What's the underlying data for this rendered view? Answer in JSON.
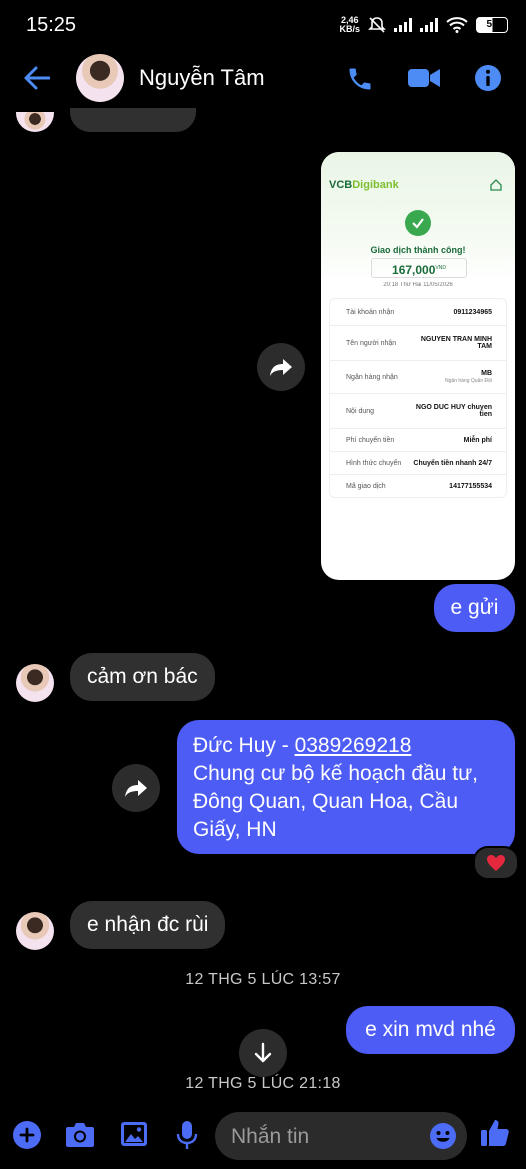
{
  "status_bar": {
    "time": "15:25",
    "net_speed_value": "2,46",
    "net_speed_unit": "KB/s",
    "battery": "51"
  },
  "header": {
    "contact_name": "Nguyễn Tâm",
    "icons": [
      "back-arrow-icon",
      "phone-icon",
      "video-camera-icon",
      "info-icon"
    ],
    "accent_color": "#4d6cf5"
  },
  "receipt": {
    "bank_logo_a": "VCB",
    "bank_logo_b": "Digibank",
    "status": "Giao dịch thành công!",
    "amount": "167,000",
    "currency": "VND",
    "datetime": "20:18 Thứ Hai 11/05/2026",
    "rows": [
      {
        "label": "Tài khoản nhận",
        "value": "0911234965"
      },
      {
        "label": "Tên người nhận",
        "value": "NGUYEN TRAN MINH TAM"
      },
      {
        "label": "Ngân hàng nhận",
        "value": "MB",
        "sub": "Ngân hàng Quân Đội"
      },
      {
        "label": "Nội dung",
        "value": "NGO DUC HUY chuyen tien"
      },
      {
        "label": "Phí chuyển tiền",
        "value": "Miễn phí"
      },
      {
        "label": "Hình thức chuyển",
        "value": "Chuyển tiền nhanh 24/7"
      },
      {
        "label": "Mã giao dịch",
        "value": "14177155534"
      }
    ]
  },
  "messages": {
    "sent_1": "e gửi",
    "received_1": "cảm ơn bác",
    "sent_2_name": "Đức Huy - ",
    "sent_2_phone": "0389269218",
    "sent_2_address_1": "Chung cư bộ kế hoạch đầu tư,",
    "sent_2_address_2": "Đông Quan, Quan Hoa, Cầu",
    "sent_2_address_3": "Giấy, HN",
    "reaction": "❤️",
    "received_2": "e nhận đc rùi",
    "timestamp_1": "12 THG 5 LÚC 13:57",
    "sent_3": "e xin mvd nhé",
    "timestamp_2": "12 THG 5 LÚC 21:18"
  },
  "composer": {
    "placeholder": "Nhắn tin",
    "icons": [
      "plus-icon",
      "camera-icon",
      "gallery-icon",
      "microphone-icon",
      "emoji-icon",
      "thumbs-up-icon"
    ]
  }
}
